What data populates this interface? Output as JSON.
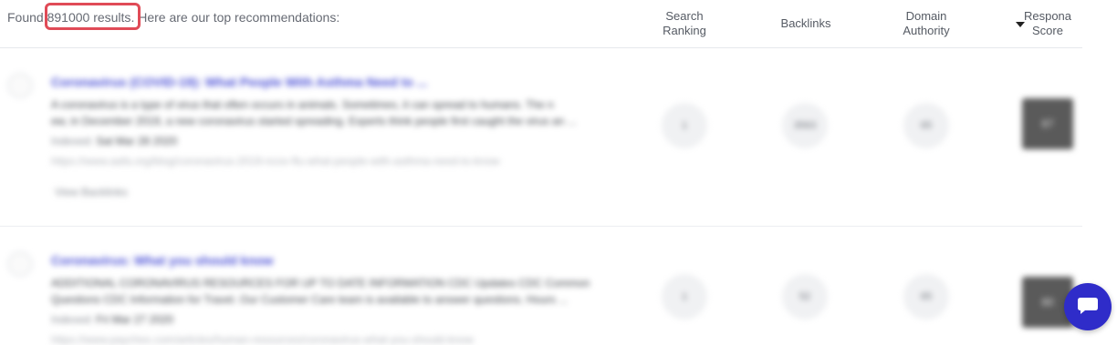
{
  "summary": {
    "prefix": "Found ",
    "count": "891000 results",
    "suffix": ". Here are our top recommendations:"
  },
  "columns": {
    "ranking_line1": "Search",
    "ranking_line2": "Ranking",
    "backlinks": "Backlinks",
    "authority_line1": "Domain",
    "authority_line2": "Authority",
    "score_line1": "Respona",
    "score_line2": "Score"
  },
  "results": [
    {
      "title": "Coronavirus (COVID-19): What People With Asthma Need to ...",
      "snippet": [
        "A coronavirus is a type of virus that often occurs in animals. Sometimes, it can spread to humans. The n",
        "ew, in December 2019, a new coronavirus started spreading. Experts think people first caught the virus an ..."
      ],
      "date_label": "Indexed:",
      "date": "Sat Mar 28 2020",
      "url": "https://www.aafa.org/blog/coronavirus-2019-ncov-flu-what-people-with-asthma-need-to-know",
      "backlinks_link": "View Backlinks",
      "ranking": "1",
      "backlinks": "3563",
      "authority": "65",
      "score": "87"
    },
    {
      "title": "Coronavirus: What you should know",
      "snippet": [
        "ADDITIONAL CORONAVIRUS RESOURCES FOR UP TO DATE INFORMATION CDC Updates CDC Common",
        "Questions CDC Information for Travel. Our Customer Care team is available to answer questions. Hours ..."
      ],
      "date_label": "Indexed:",
      "date": "Fri Mar 27 2020",
      "url": "https://www.paychex.com/articles/human-resources/coronavirus-what-you-should-know",
      "ranking": "1",
      "backlinks": "52",
      "authority": "65",
      "score": "80"
    }
  ]
}
